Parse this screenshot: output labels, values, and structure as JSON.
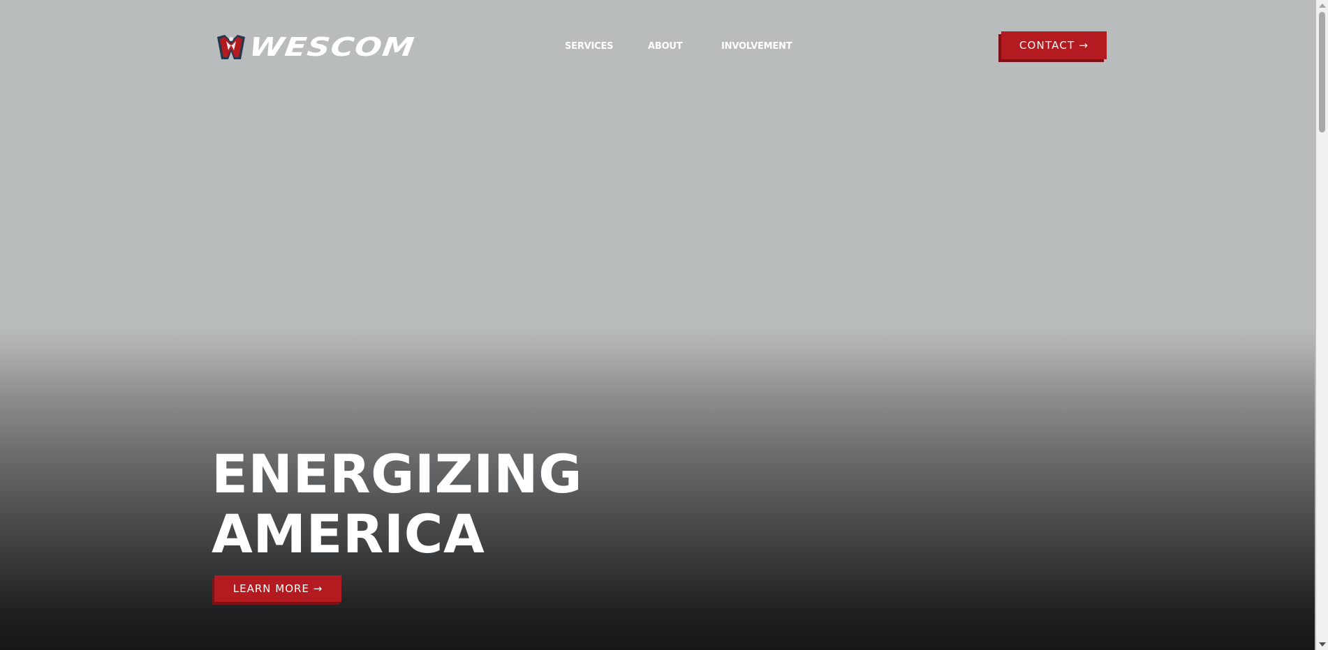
{
  "header": {
    "logo_text": "WESCOM",
    "nav": [
      {
        "label": "SERVICES"
      },
      {
        "label": "ABOUT"
      },
      {
        "label": "INVOLVEMENT"
      }
    ],
    "contact_label": "CONTACT →"
  },
  "hero": {
    "headline_line1": "ENERGIZING",
    "headline_line2": "AMERICA",
    "cta_label": "LEARN MORE →"
  },
  "colors": {
    "accent": "#b31b20",
    "accent_shadow": "#7a1417",
    "text": "#ffffff",
    "hero_top": "#b9bcbd",
    "hero_bottom": "#161718"
  }
}
